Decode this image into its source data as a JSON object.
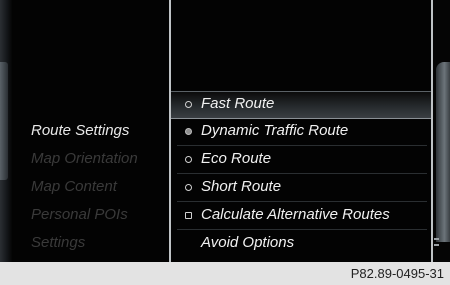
{
  "left_menu": {
    "items": [
      {
        "label": "Route Settings",
        "active": true
      },
      {
        "label": "Map Orientation",
        "active": false
      },
      {
        "label": "Map Content",
        "active": false
      },
      {
        "label": "Personal POIs",
        "active": false
      },
      {
        "label": "Settings",
        "active": false
      }
    ]
  },
  "options": {
    "items": [
      {
        "label": "Fast Route",
        "icon": "radio-empty-icon",
        "selected": true
      },
      {
        "label": "Dynamic Traffic Route",
        "icon": "radio-filled-icon",
        "selected": false
      },
      {
        "label": "Eco Route",
        "icon": "radio-empty-icon",
        "selected": false
      },
      {
        "label": "Short Route",
        "icon": "radio-empty-icon",
        "selected": false
      },
      {
        "label": "Calculate Alternative Routes",
        "icon": "checkbox-icon",
        "selected": false
      },
      {
        "label": "Avoid Options",
        "icon": "",
        "selected": false
      }
    ]
  },
  "caption": {
    "code": "P82.89-0495-31"
  },
  "colors": {
    "active_text": "#e8e8e8",
    "inactive_text": "#3a3a3a",
    "divider": "#bfc3c6",
    "caption_bg": "#e3e3e3"
  }
}
